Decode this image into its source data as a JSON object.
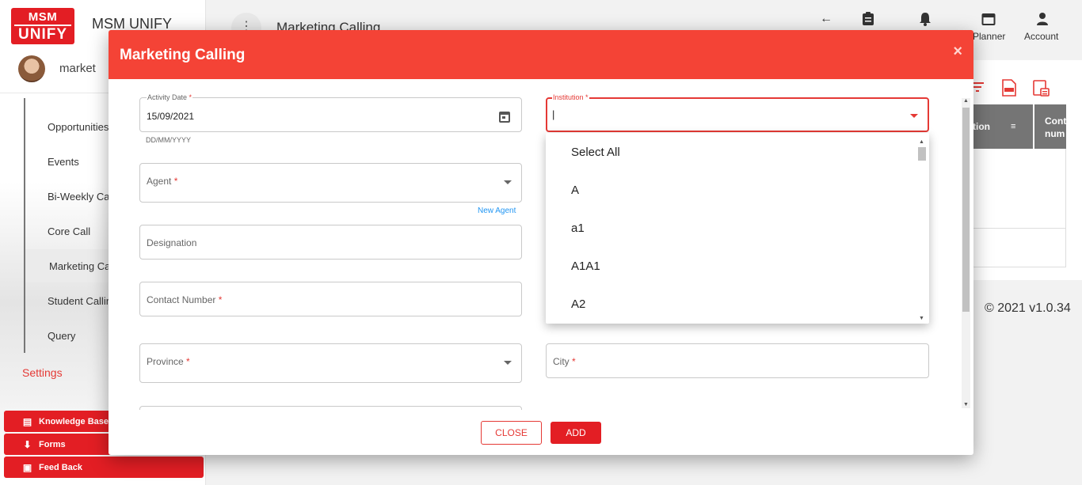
{
  "app": {
    "logo_line1": "MSM",
    "logo_line2": "UNIFY",
    "title": "MSM UNIFY",
    "user_name": "market"
  },
  "sidebar": {
    "items": [
      {
        "label": "Opportunities"
      },
      {
        "label": "Events"
      },
      {
        "label": "Bi-Weekly Cal"
      },
      {
        "label": "Core Call"
      },
      {
        "label": "Marketing Ca"
      },
      {
        "label": "Student Callin"
      },
      {
        "label": "Query"
      }
    ],
    "settings_label": "Settings",
    "buttons": [
      {
        "label": "Knowledge Base",
        "icon": "book-icon"
      },
      {
        "label": "Forms",
        "icon": "download-icon"
      },
      {
        "label": "Feed Back",
        "icon": "feedback-icon"
      }
    ]
  },
  "topbar": {
    "page_title": "Marketing Calling",
    "planner_label": "Planner",
    "account_label": "Account"
  },
  "background_table": {
    "col1": "tion",
    "col2_line1": "Cont",
    "col2_line2": "num"
  },
  "footer": {
    "copyright": "© 2021 v1.0.34"
  },
  "modal": {
    "title": "Marketing Calling",
    "close_symbol": "×",
    "fields": {
      "activity_date": {
        "label": "Activity Date",
        "value": "15/09/2021",
        "hint": "DD/MM/YYYY"
      },
      "institution": {
        "label": "Institution",
        "value": "|"
      },
      "agent": {
        "label": "Agent",
        "link": "New Agent"
      },
      "designation": {
        "label": "Designation"
      },
      "contact_number": {
        "label": "Contact Number"
      },
      "province": {
        "label": "Province"
      },
      "city": {
        "label": "City"
      }
    },
    "required_mark": "*",
    "close_button": "CLOSE",
    "add_button": "ADD"
  },
  "institution_dropdown": {
    "options": [
      "Select All",
      "A",
      "a1",
      "A1A1",
      "A2"
    ]
  },
  "colors": {
    "brand_red": "#e31e24",
    "header_red": "#f44336",
    "link_blue": "#2196f3"
  }
}
